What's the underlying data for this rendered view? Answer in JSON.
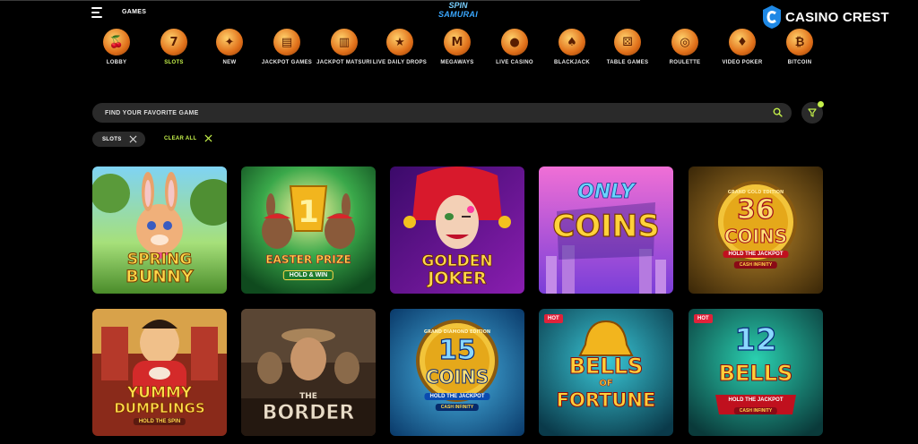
{
  "header": {
    "games_label": "GAMES",
    "logo_line1": "SPIN",
    "logo_line2": "SAMURAI",
    "watermark": "CASINO CREST"
  },
  "categories": [
    {
      "label": "LOBBY",
      "icon": "cherries-icon",
      "active": false
    },
    {
      "label": "SLOTS",
      "icon": "slot-seven-icon",
      "active": true
    },
    {
      "label": "NEW",
      "icon": "shuriken-icon",
      "active": false
    },
    {
      "label": "JACKPOT GAMES",
      "icon": "gold-bars-icon",
      "active": false
    },
    {
      "label": "JACKPOT MATSURI",
      "icon": "gold-stack-icon",
      "active": false
    },
    {
      "label": "LIVE DAILY DROPS",
      "icon": "drops-wins-icon",
      "active": false
    },
    {
      "label": "MEGAWAYS",
      "icon": "megaways-m-icon",
      "active": false
    },
    {
      "label": "LIVE CASINO",
      "icon": "poker-chip-icon",
      "active": false
    },
    {
      "label": "BLACKJACK",
      "icon": "spade-icon",
      "active": false
    },
    {
      "label": "TABLE GAMES",
      "icon": "dice-icon",
      "active": false
    },
    {
      "label": "ROULETTE",
      "icon": "roulette-wheel-icon",
      "active": false
    },
    {
      "label": "VIDEO POKER",
      "icon": "playing-cards-icon",
      "active": false
    },
    {
      "label": "BITCOIN",
      "icon": "bitcoin-icon",
      "active": false
    }
  ],
  "search": {
    "placeholder": "FIND YOUR FAVORITE GAME",
    "value": ""
  },
  "filters": {
    "chip_label": "SLOTS",
    "clear_label": "CLEAR ALL"
  },
  "games": [
    {
      "title_top": "SPRING",
      "title_bottom": "BUNNY",
      "subtitle": "",
      "hot": false
    },
    {
      "title_top": "EASTER PRIZE",
      "title_bottom": "",
      "subtitle": "HOLD & WIN",
      "hot": false
    },
    {
      "title_top": "GOLDEN",
      "title_bottom": "JOKER",
      "subtitle": "",
      "hot": false
    },
    {
      "title_top": "ONLY",
      "title_bottom": "COINS",
      "subtitle": "",
      "hot": false
    },
    {
      "title_top": "36",
      "title_bottom": "COINS",
      "subtitle": "HOLD THE JACKPOT",
      "hot": false,
      "edition": "GRAND GOLD EDITION",
      "extra": "CASH INFINITY"
    },
    {
      "title_top": "YUMMY",
      "title_bottom": "DUMPLINGS",
      "subtitle": "HOLD THE SPIN",
      "hot": false
    },
    {
      "title_top": "",
      "title_bottom": "BORDER",
      "subtitle": "",
      "hot": false,
      "prefix": "THE"
    },
    {
      "title_top": "15",
      "title_bottom": "COINS",
      "subtitle": "HOLD THE JACKPOT",
      "hot": false,
      "edition": "GRAND DIAMOND EDITION",
      "extra": "CASH INFINITY"
    },
    {
      "title_top": "BELLS",
      "title_bottom": "FORTUNE",
      "subtitle": "",
      "hot": true,
      "mid": "OF"
    },
    {
      "title_top": "12",
      "title_bottom": "BELLS",
      "subtitle": "HOLD THE JACKPOT",
      "hot": true,
      "extra": "CASH INFINITY"
    }
  ],
  "badges": {
    "hot": "HOT"
  }
}
